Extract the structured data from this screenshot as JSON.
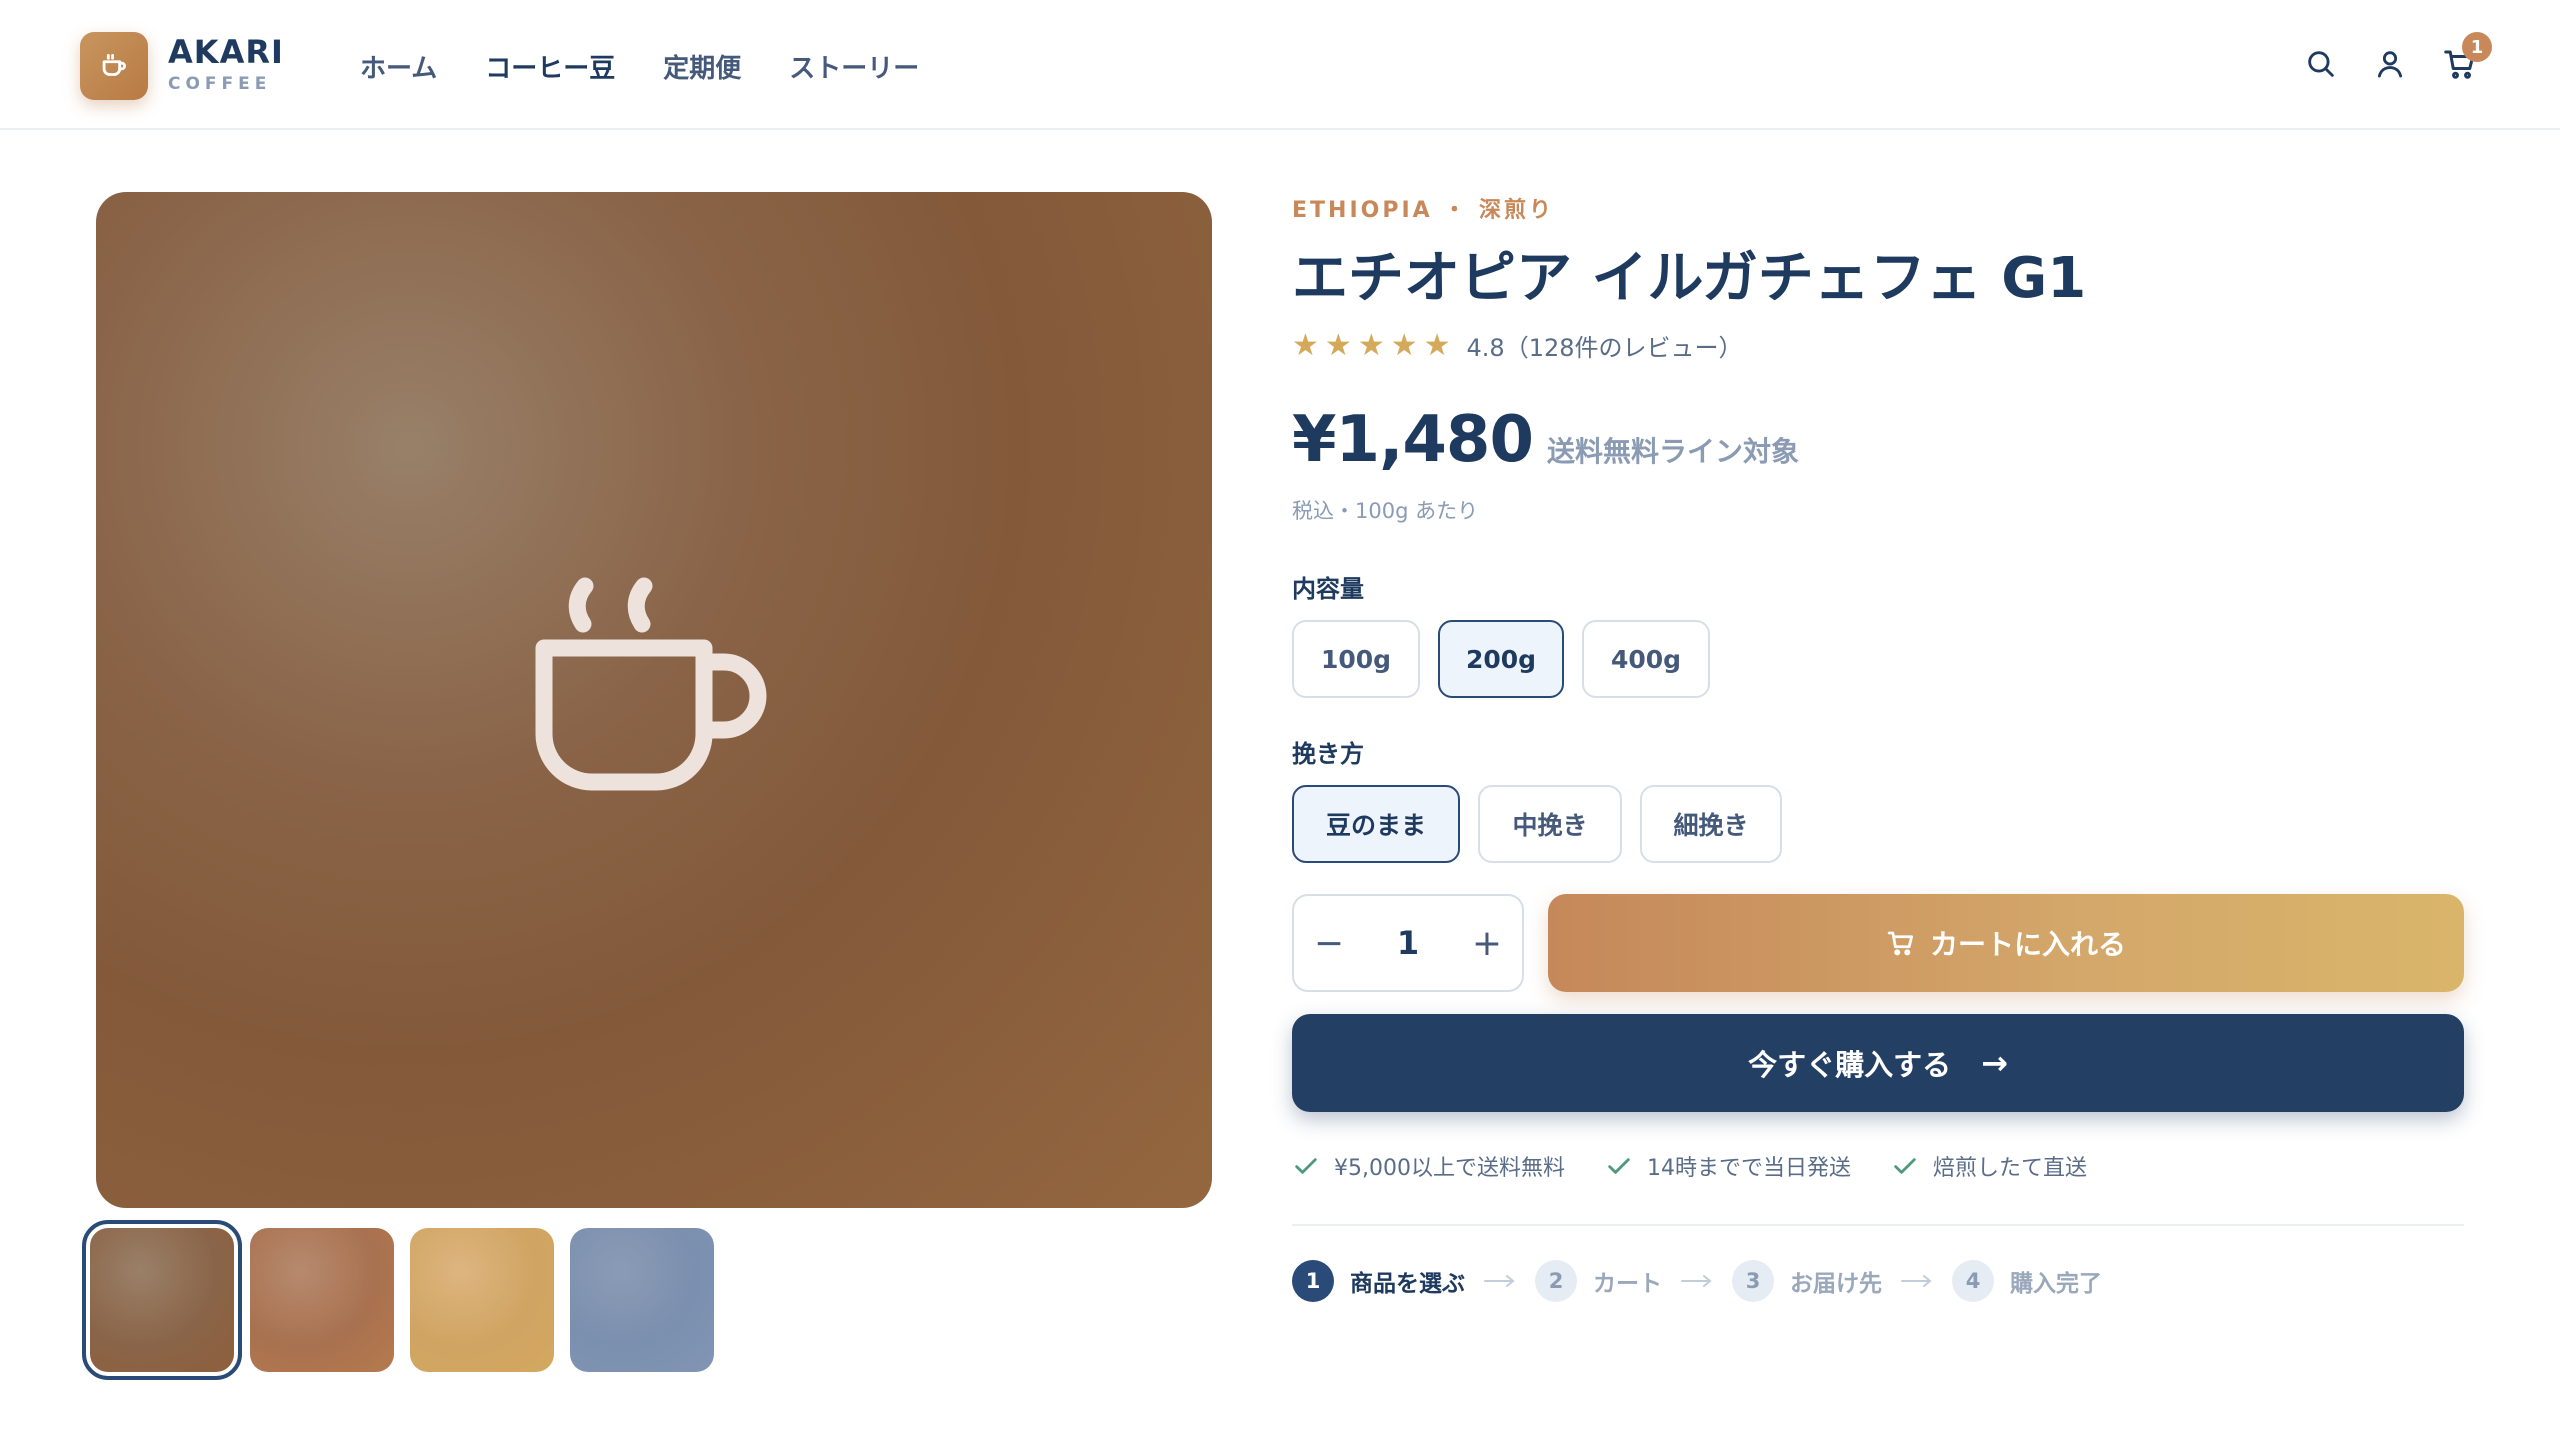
{
  "header": {
    "brand_name": "AKARI",
    "brand_sub": "COFFEE",
    "nav": [
      {
        "label": "ホーム"
      },
      {
        "label": "コーヒー豆"
      },
      {
        "label": "定期便"
      },
      {
        "label": "ストーリー"
      }
    ],
    "cart_count": "1",
    "icons": [
      "coffee-cup-icon",
      "search-icon",
      "user-icon",
      "cart-icon"
    ]
  },
  "gallery": {
    "main_icon": "coffee-cup-icon",
    "thumbnails": [
      {
        "color": "#8a6448",
        "selected": true
      },
      {
        "color": "#a8714f",
        "selected": false
      },
      {
        "color": "#d0a462",
        "selected": false
      },
      {
        "color": "#7b8fae",
        "selected": false
      }
    ]
  },
  "product": {
    "origin": "ETHIOPIA ・ 深煎り",
    "title": "エチオピア イルガチェフェ G1",
    "rating": 4.8,
    "rating_text": "4.8（128件のレビュー）",
    "price": "¥1,480",
    "free_shipping_note": "送料無料ライン対象",
    "tax_note": "税込・100g あたり",
    "size_label": "内容量",
    "sizes": [
      {
        "label": "100g",
        "selected": false
      },
      {
        "label": "200g",
        "selected": true
      },
      {
        "label": "400g",
        "selected": false
      }
    ],
    "grind_label": "挽き方",
    "grinds": [
      {
        "label": "豆のまま",
        "selected": true
      },
      {
        "label": "中挽き",
        "selected": false
      },
      {
        "label": "細挽き",
        "selected": false
      }
    ],
    "quantity": "1",
    "minus_label": "−",
    "plus_label": "+",
    "add_to_cart_label": "カートに入れる",
    "buy_now_label": "今すぐ購入する",
    "buy_now_arrow": "→",
    "features": [
      {
        "label": "¥5,000以上で送料無料"
      },
      {
        "label": "14時までで当日発送"
      },
      {
        "label": "焙煎したて直送"
      }
    ],
    "steps": [
      {
        "num": "1",
        "label": "商品を選ぶ",
        "active": true
      },
      {
        "num": "2",
        "label": "カート",
        "active": false
      },
      {
        "num": "3",
        "label": "お届け先",
        "active": false
      },
      {
        "num": "4",
        "label": "購入完了",
        "active": false
      }
    ]
  },
  "colors": {
    "navy": "#1f3a5f",
    "accent": "#c8885a",
    "gold": "#d4a95a"
  }
}
